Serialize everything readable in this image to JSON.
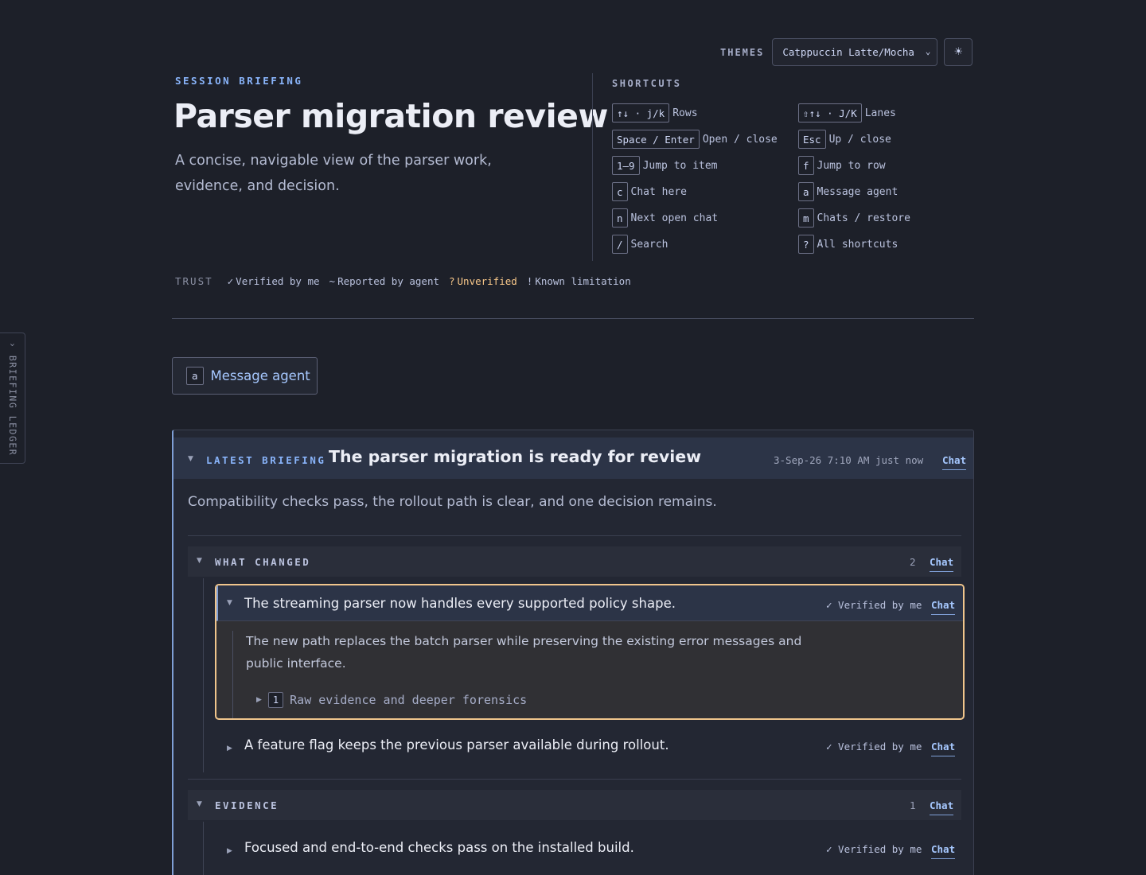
{
  "sidebar": {
    "ledger_label": "BRIEFING LEDGER",
    "ledger_chevron": "›"
  },
  "themes": {
    "label": "THEMES",
    "selected": "Catppuccin Latte/Mocha",
    "toggle_icon": "☀"
  },
  "header": {
    "eyebrow": "SESSION BRIEFING",
    "title": "Parser migration review",
    "description": "A concise, navigable view of the parser work, evidence, and decision."
  },
  "shortcuts": {
    "title": "SHORTCUTS",
    "items": [
      {
        "key": "↑↓ · j/k",
        "label": "Rows"
      },
      {
        "key": "⇧↑↓ · J/K",
        "label": "Lanes"
      },
      {
        "key": "Space / Enter",
        "label": "Open / close"
      },
      {
        "key": "Esc",
        "label": "Up / close"
      },
      {
        "key": "1–9",
        "label": "Jump to item"
      },
      {
        "key": "f",
        "label": "Jump to row"
      },
      {
        "key": "c",
        "label": "Chat here"
      },
      {
        "key": "a",
        "label": "Message agent"
      },
      {
        "key": "n",
        "label": "Next open chat"
      },
      {
        "key": "m",
        "label": "Chats / restore"
      },
      {
        "key": "/",
        "label": "Search"
      },
      {
        "key": "?",
        "label": "All shortcuts"
      }
    ]
  },
  "trust": {
    "label": "TRUST",
    "items": [
      {
        "symbol": "✓",
        "label": "Verified by me"
      },
      {
        "symbol": "~",
        "label": "Reported by agent"
      },
      {
        "symbol": "?",
        "label": "Unverified"
      },
      {
        "symbol": "!",
        "label": "Known limitation"
      }
    ],
    "colors": {
      "unverified": "#f9c88a"
    }
  },
  "message_agent": {
    "key": "a",
    "label": "Message agent"
  },
  "briefing": {
    "eyebrow": "LATEST BRIEFING",
    "title": "The parser migration is ready for review",
    "date": "3-Sep-26 7:10 AM",
    "relative": "just now",
    "chat_label": "Chat",
    "summary": "Compatibility checks pass, the rollout path is clear, and one decision remains.",
    "sections": [
      {
        "title": "WHAT CHANGED",
        "count": "2",
        "chat_label": "Chat",
        "items": [
          {
            "text": "The streaming parser now handles every supported policy shape.",
            "trust": "✓ Verified by me",
            "chat_label": "Chat",
            "detail": "The new path replaces the batch parser while preserving the existing error messages and public interface.",
            "evidence_key": "1",
            "evidence_label": "Raw evidence and deeper forensics"
          },
          {
            "text": "A feature flag keeps the previous parser available during rollout.",
            "trust": "✓ Verified by me",
            "chat_label": "Chat"
          }
        ]
      },
      {
        "title": "EVIDENCE",
        "count": "1",
        "chat_label": "Chat",
        "items": [
          {
            "text": "Focused and end-to-end checks pass on the installed build.",
            "trust": "✓ Verified by me",
            "chat_label": "Chat"
          }
        ]
      }
    ]
  },
  "colors": {
    "background": "#1d2029",
    "accent": "#89b4fa",
    "active_border": "#f0c58c"
  }
}
